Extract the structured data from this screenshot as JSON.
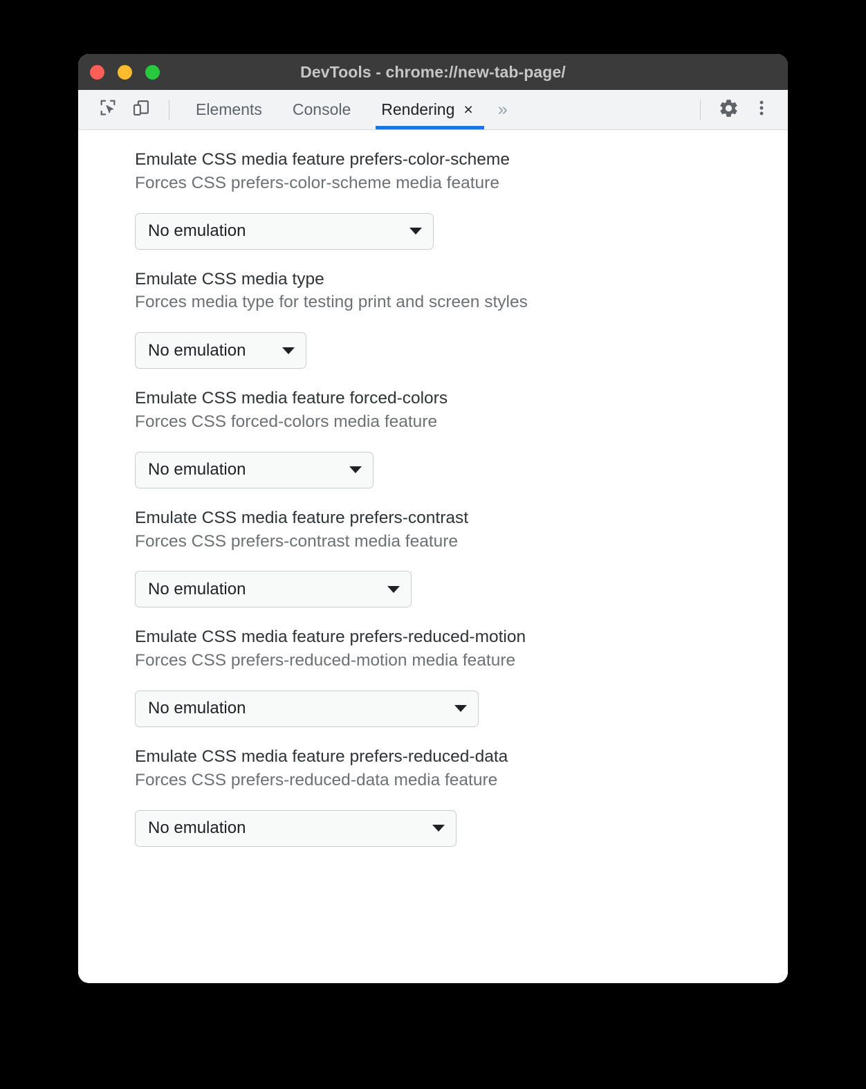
{
  "window": {
    "title": "DevTools - chrome://new-tab-page/",
    "traffic_lights": [
      {
        "name": "close",
        "color": "#ff5f56"
      },
      {
        "name": "minimize",
        "color": "#fdbc2e"
      },
      {
        "name": "maximize",
        "color": "#27c93f"
      }
    ]
  },
  "toolbar": {
    "inspect_icon": "inspect-element-icon",
    "device_icon": "device-toolbar-icon",
    "tabs": [
      {
        "label": "Elements",
        "active": false
      },
      {
        "label": "Console",
        "active": false
      },
      {
        "label": "Rendering",
        "active": true,
        "close": "×"
      }
    ],
    "more_tabs": "»",
    "settings_icon": "gear-icon",
    "menu_icon": "more-vertical-icon",
    "accent_color": "#1a73e8"
  },
  "settings": [
    {
      "title": "Emulate CSS media feature prefers-color-scheme",
      "description": "Forces CSS prefers-color-scheme media feature",
      "value": "No emulation"
    },
    {
      "title": "Emulate CSS media type",
      "description": "Forces media type for testing print and screen styles",
      "value": "No emulation"
    },
    {
      "title": "Emulate CSS media feature forced-colors",
      "description": "Forces CSS forced-colors media feature",
      "value": "No emulation"
    },
    {
      "title": "Emulate CSS media feature prefers-contrast",
      "description": "Forces CSS prefers-contrast media feature",
      "value": "No emulation"
    },
    {
      "title": "Emulate CSS media feature prefers-reduced-motion",
      "description": "Forces CSS prefers-reduced-motion media feature",
      "value": "No emulation"
    },
    {
      "title": "Emulate CSS media feature prefers-reduced-data",
      "description": "Forces CSS prefers-reduced-data media feature",
      "value": "No emulation"
    }
  ]
}
